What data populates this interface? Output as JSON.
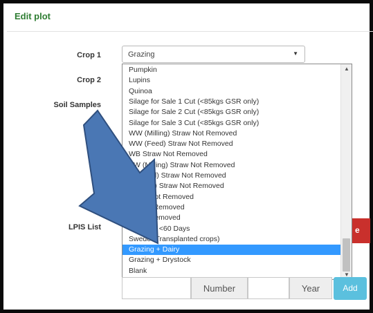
{
  "header": {
    "title": "Edit plot"
  },
  "form": {
    "crop1_label": "Crop 1",
    "crop2_label": "Crop 2",
    "soil_label": "Soil Samples",
    "lpis_label": "LPIS List",
    "crop1_value": "Grazing"
  },
  "dropdown": {
    "options": [
      "Pumpkin",
      "Lupins",
      "Quinoa",
      "Silage for Sale 1 Cut (<85kgs GSR only)",
      "Silage for Sale 2 Cut (<85kgs GSR only)",
      "Silage for Sale 3 Cut (<85kgs GSR only)",
      "WW (Milling) Straw Not Removed",
      "WW (Feed) Straw Not Removed",
      "WB Straw Not Removed",
      "SW (Milling) Straw Not Removed",
      "W (Feed) Straw Not Removed",
      "(Malting) Straw Not Removed",
      "Straw Not Removed",
      "aw Not Removed",
      "w Not Removed",
      "es Salad <60 Days",
      "Swede (Transplanted crops)",
      "Grazing + Dairy",
      "Grazing + Drystock",
      "Blank"
    ],
    "selected_index": 17
  },
  "bottom": {
    "number_label": "Number",
    "year_label": "Year",
    "add_label": "Add"
  },
  "background": {
    "red_button_fragment": "e"
  },
  "colors": {
    "header_text": "#2e7d32",
    "selected_option": "#3399ff",
    "add_button": "#5bc0de",
    "red_button": "#c9302c",
    "arrow_fill": "#4a77b4",
    "arrow_stroke": "#2f4f7e"
  },
  "icons": {
    "select_caret": "caret-down-icon",
    "scroll_up": "scroll-up-icon",
    "scroll_down": "scroll-down-icon",
    "annotation": "arrow-icon"
  }
}
